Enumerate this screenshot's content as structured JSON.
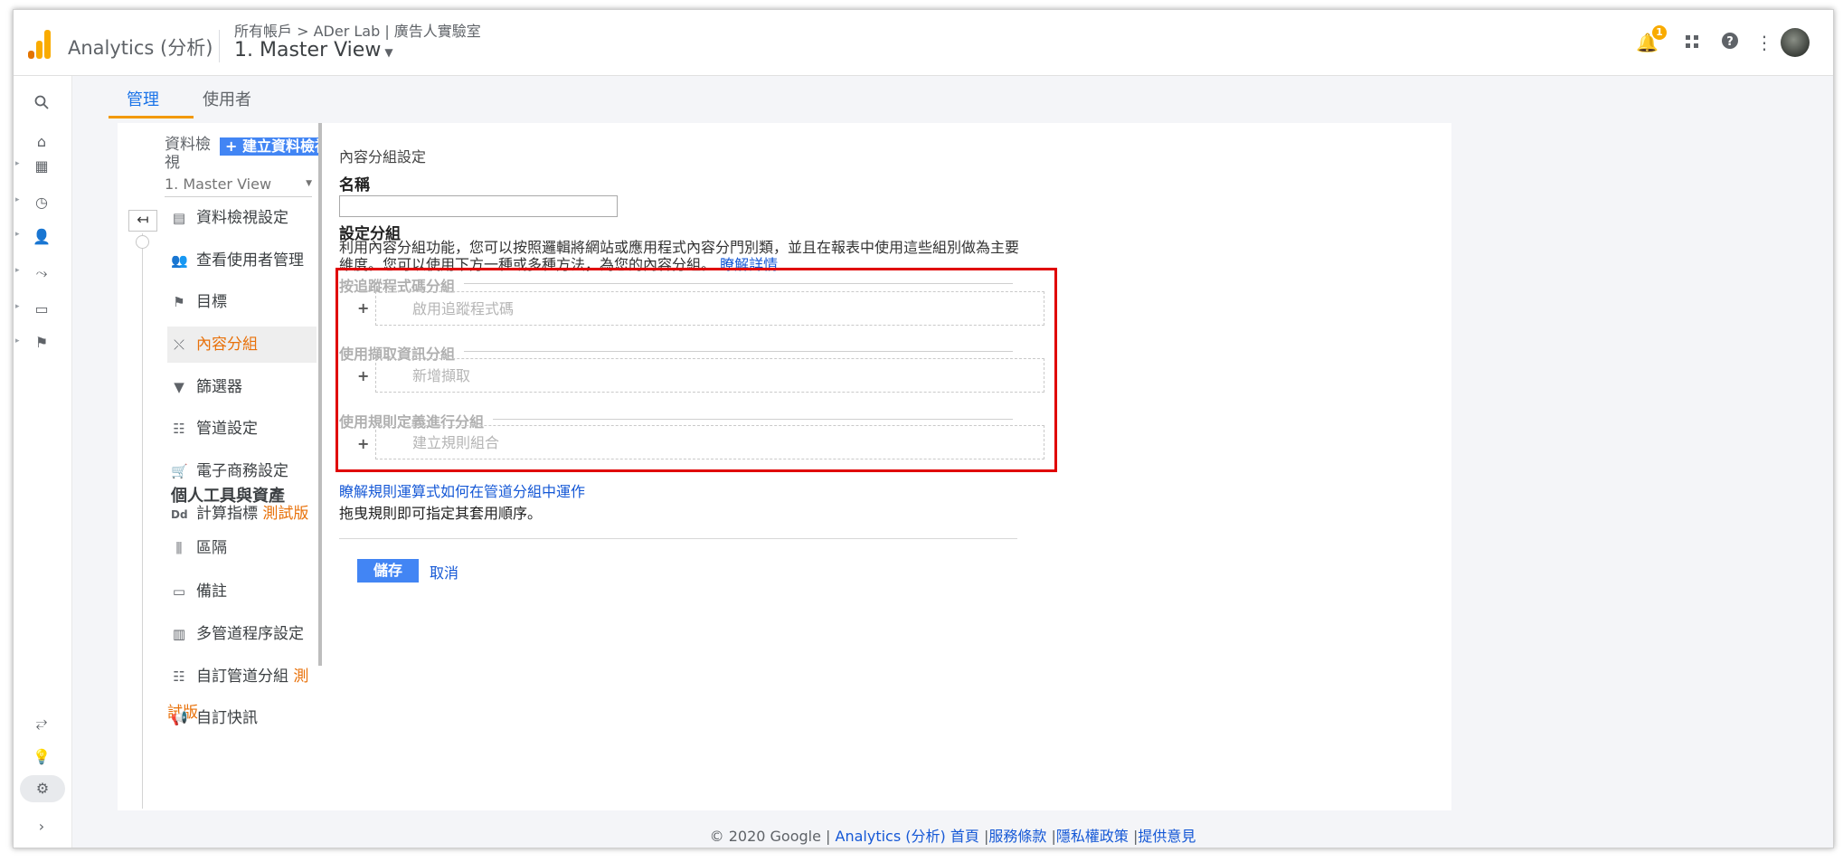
{
  "topbar": {
    "app_name": "Analytics (分析)",
    "breadcrumb": "所有帳戶 > ADer Lab | 廣告人實驗室",
    "view_name": "1. Master View",
    "notification_count": "1",
    "icons": [
      "bell-icon",
      "apps-grid-icon",
      "help-icon",
      "more-vert-icon",
      "avatar"
    ]
  },
  "tabs": {
    "admin": "管理",
    "user": "使用者"
  },
  "nav": {
    "title": "資料檢視",
    "new_view": "+ 建立資料檢視",
    "selected_view": "1. Master View",
    "items": [
      {
        "label": "資料檢視設定"
      },
      {
        "label": "查看使用者管理"
      },
      {
        "label": "目標"
      },
      {
        "label": "內容分組"
      },
      {
        "label": "篩選器"
      },
      {
        "label": "管道設定"
      },
      {
        "label": "電子商務設定"
      },
      {
        "label": "計算指標",
        "beta": "測試版"
      },
      {
        "label": "區隔"
      },
      {
        "label": "備註"
      },
      {
        "label": "多管道程序設定"
      },
      {
        "label": "自訂管道分組",
        "beta": "測試版"
      },
      {
        "label": "自訂快訊"
      }
    ],
    "personal_section": "個人工具與資產"
  },
  "form": {
    "title": "內容分組設定",
    "name_label": "名稱",
    "name_value": "",
    "group_label": "設定分組",
    "description": "利用內容分組功能，您可以按照邏輯將網站或應用程式內容分門別類，並且在報表中使用這些組別做為主要維度。您可以使用下方一種或多種方法，為您的內容分組。",
    "learn_more": "瞭解詳情",
    "sections": [
      {
        "heading": "按追蹤程式碼分組",
        "button": "啟用追蹤程式碼"
      },
      {
        "heading": "使用擷取資訊分組",
        "button": "新增擷取"
      },
      {
        "heading": "使用規則定義進行分組",
        "button": "建立規則組合"
      }
    ],
    "rules_link": "瞭解規則運算式如何在管道分組中運作",
    "drag_note": "拖曳規則即可指定其套用順序。",
    "save": "儲存",
    "cancel": "取消"
  },
  "footer": {
    "copyright": "© 2020 Google |",
    "home": "Analytics (分析) 首頁",
    "sep1": "|",
    "terms": "服務條款",
    "sep2": "|",
    "privacy": "隱私權政策",
    "sep3": "|",
    "feedback": "提供意見"
  },
  "colors": {
    "accent": "#1a73e8",
    "tab_underline": "#f29900",
    "active_nav": "#e8710a",
    "highlight_box": "#e00000"
  }
}
